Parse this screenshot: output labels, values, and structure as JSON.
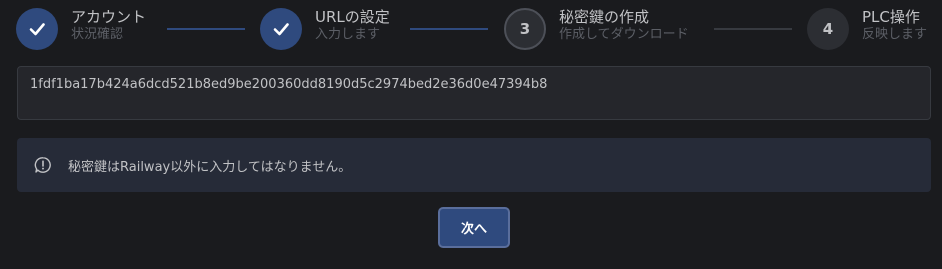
{
  "stepper": {
    "steps": [
      {
        "label": "アカウント",
        "description": "状況確認",
        "number": "",
        "state": "done",
        "icon": "check-icon"
      },
      {
        "label": "URLの設定",
        "description": "入力します",
        "number": "",
        "state": "done",
        "icon": "check-icon"
      },
      {
        "label": "秘密鍵の作成",
        "description": "作成してダウンロード",
        "number": "3",
        "state": "current"
      },
      {
        "label": "PLC操作",
        "description": "反映します",
        "number": "4",
        "state": "pending"
      }
    ]
  },
  "key_field": {
    "value": "1fdf1ba17b424a6dcd521b8ed9be200360dd8190d5c2974bed2e36d0e47394b8"
  },
  "alert": {
    "icon": "info-circle-icon",
    "message": "秘密鍵はRailway以外に入力してはなりません。"
  },
  "actions": {
    "next_label": "次へ"
  },
  "colors": {
    "background": "#1a1b1e",
    "accent": "#2f4a7e",
    "alert_bg": "#262b38"
  }
}
